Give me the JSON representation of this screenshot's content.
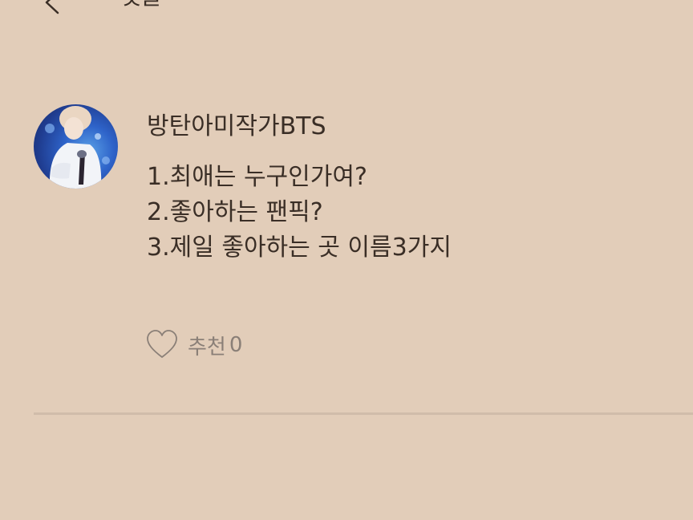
{
  "header": {
    "title": "댓글"
  },
  "comment": {
    "author": "방탄아미작가BTS",
    "lines": [
      "1.최애는 누구인가여?",
      "2.좋아하는 팬픽?",
      "3.제일 좋아하는 곳 이름3가지"
    ],
    "like_label": "추천",
    "like_count": "0"
  },
  "colors": {
    "background": "#e2cdb9",
    "text": "#3a2e26",
    "muted": "#8a7f77",
    "divider": "#d0bcaa"
  },
  "icons": {
    "back": "back-arrow-icon",
    "like": "heart-outline-icon"
  }
}
